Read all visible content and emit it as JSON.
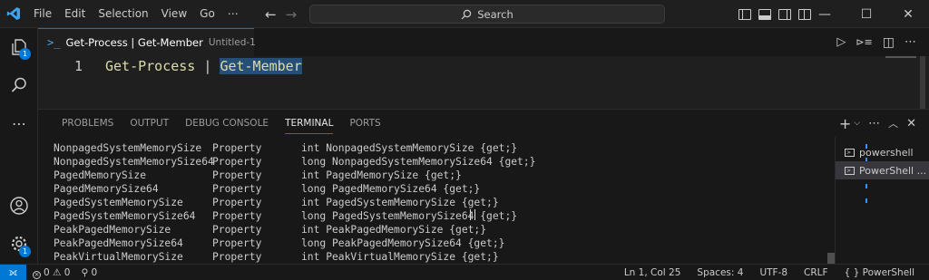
{
  "menu": {
    "file": "File",
    "edit": "Edit",
    "selection": "Selection",
    "view": "View",
    "go": "Go",
    "more": "⋯"
  },
  "search": {
    "label": "Search"
  },
  "window": {
    "minimize": "—",
    "maximize": "☐",
    "close": "✕"
  },
  "activity": {
    "explorer_badge": "1",
    "accounts_badge": "1"
  },
  "tab": {
    "title": "Get-Process | Get-Member",
    "subtitle": "Untitled-1"
  },
  "editor": {
    "line_number": "1",
    "tokens": {
      "cmd1": "Get-Process",
      "pipe": " | ",
      "cmd2": "Get-Member"
    }
  },
  "panel": {
    "tabs": [
      "PROBLEMS",
      "OUTPUT",
      "DEBUG CONSOLE",
      "TERMINAL",
      "PORTS"
    ],
    "active_tab": "TERMINAL"
  },
  "terminal_rows": [
    [
      "NonpagedSystemMemorySize",
      "Property",
      "int NonpagedSystemMemorySize {get;}"
    ],
    [
      "NonpagedSystemMemorySize64",
      "Property",
      "long NonpagedSystemMemorySize64 {get;}"
    ],
    [
      "PagedMemorySize",
      "Property",
      "int PagedMemorySize {get;}"
    ],
    [
      "PagedMemorySize64",
      "Property",
      "long PagedMemorySize64 {get;}"
    ],
    [
      "PagedSystemMemorySize",
      "Property",
      "int PagedSystemMemorySize {get;}"
    ],
    [
      "PagedSystemMemorySize64",
      "Property",
      "long PagedSystemMemorySize64 {get;}"
    ],
    [
      "PeakPagedMemorySize",
      "Property",
      "int PeakPagedMemorySize {get;}"
    ],
    [
      "PeakPagedMemorySize64",
      "Property",
      "long PeakPagedMemorySize64 {get;}"
    ],
    [
      "PeakVirtualMemorySize",
      "Property",
      "int PeakVirtualMemorySize {get;}"
    ]
  ],
  "terminal_list": [
    "powershell",
    "PowerShell ..."
  ],
  "status": {
    "errors": "0",
    "warnings": "0",
    "ports": "0",
    "position": "Ln 1, Col 25",
    "spaces": "Spaces: 4",
    "encoding": "UTF-8",
    "eol": "CRLF",
    "language_brace": "{ }",
    "language": "PowerShell"
  },
  "colors": {
    "accent": "#0078d4",
    "selection": "#264f78",
    "command": "#dcdcaa"
  }
}
